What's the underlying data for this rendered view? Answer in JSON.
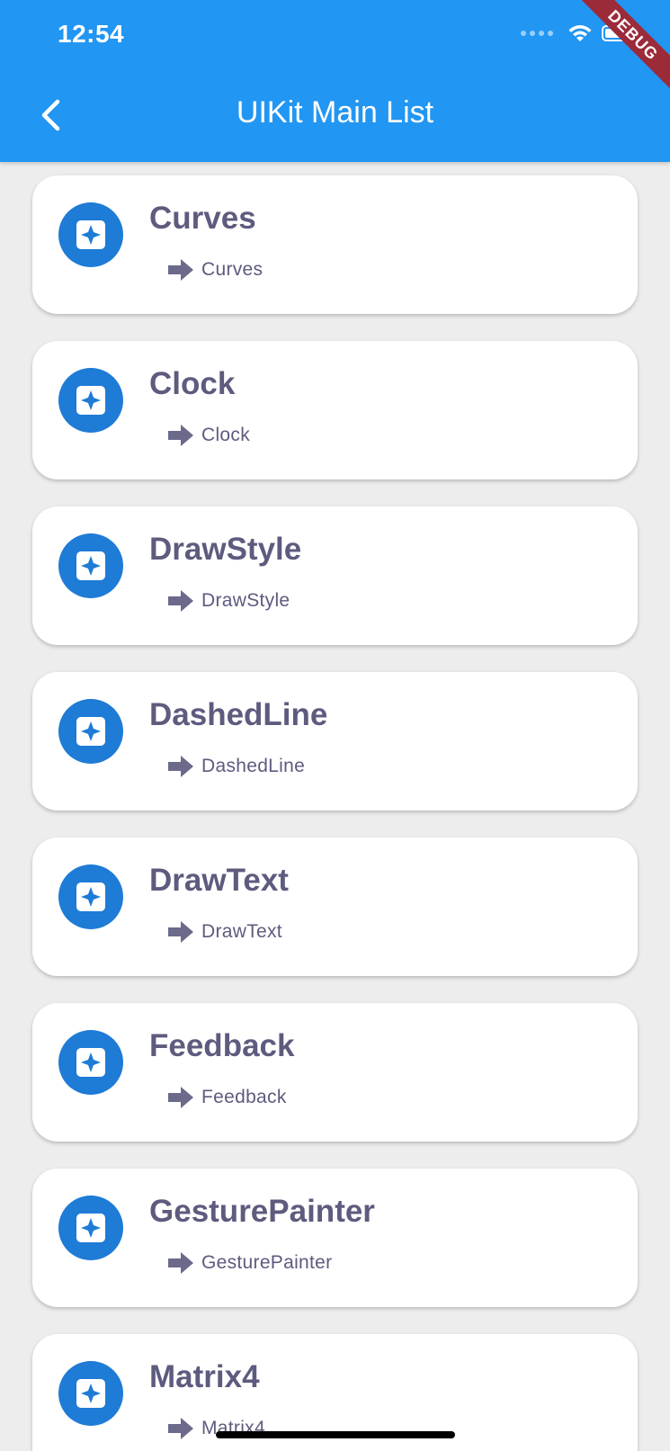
{
  "status_bar": {
    "time": "12:54",
    "icons": [
      "signal-dots-icon",
      "wifi-icon",
      "battery-icon"
    ]
  },
  "debug_banner": {
    "label": "DEBUG"
  },
  "appbar": {
    "title": "UIKit Main List",
    "back_icon": "chevron-left-icon",
    "color": "#2196f3"
  },
  "colors": {
    "icon_circle": "#1e7bd6",
    "text": "#5d5b7e",
    "background": "#ededed"
  },
  "items": [
    {
      "title": "Curves",
      "subtitle": "Curves"
    },
    {
      "title": "Clock",
      "subtitle": "Clock"
    },
    {
      "title": "DrawStyle",
      "subtitle": "DrawStyle"
    },
    {
      "title": "DashedLine",
      "subtitle": "DashedLine"
    },
    {
      "title": "DrawText",
      "subtitle": "DrawText"
    },
    {
      "title": "Feedback",
      "subtitle": "Feedback"
    },
    {
      "title": "GesturePainter",
      "subtitle": "GesturePainter"
    },
    {
      "title": "Matrix4",
      "subtitle": "Matrix4"
    }
  ]
}
